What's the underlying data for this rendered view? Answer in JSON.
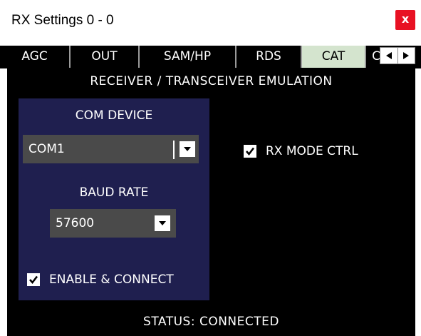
{
  "window": {
    "title": "RX Settings 0 - 0",
    "close_label": "x",
    "close_color": "#e81123"
  },
  "tabs": [
    {
      "label": "AGC",
      "active": false
    },
    {
      "label": "OUT",
      "active": false
    },
    {
      "label": "SAM/HP",
      "active": false
    },
    {
      "label": "RDS",
      "active": false
    },
    {
      "label": "CAT",
      "active": true
    },
    {
      "label": "C",
      "active": false
    }
  ],
  "tab_scroll": {
    "left_icon": "triangle-left-icon",
    "right_icon": "triangle-right-icon"
  },
  "panel": {
    "heading": "RECEIVER / TRANSCEIVER EMULATION",
    "com_device": {
      "label": "COM DEVICE",
      "value": "COM1"
    },
    "baud_rate": {
      "label": "BAUD RATE",
      "value": "57600"
    },
    "enable_connect": {
      "label": "ENABLE & CONNECT",
      "checked": true
    },
    "rx_mode_ctrl": {
      "label": "RX MODE CTRL",
      "checked": true
    },
    "status": "STATUS: CONNECTED"
  },
  "colors": {
    "active_tab": "#d4e4ce",
    "group_bg": "#1f1f4f",
    "combo_bg": "#4a4a4a"
  }
}
